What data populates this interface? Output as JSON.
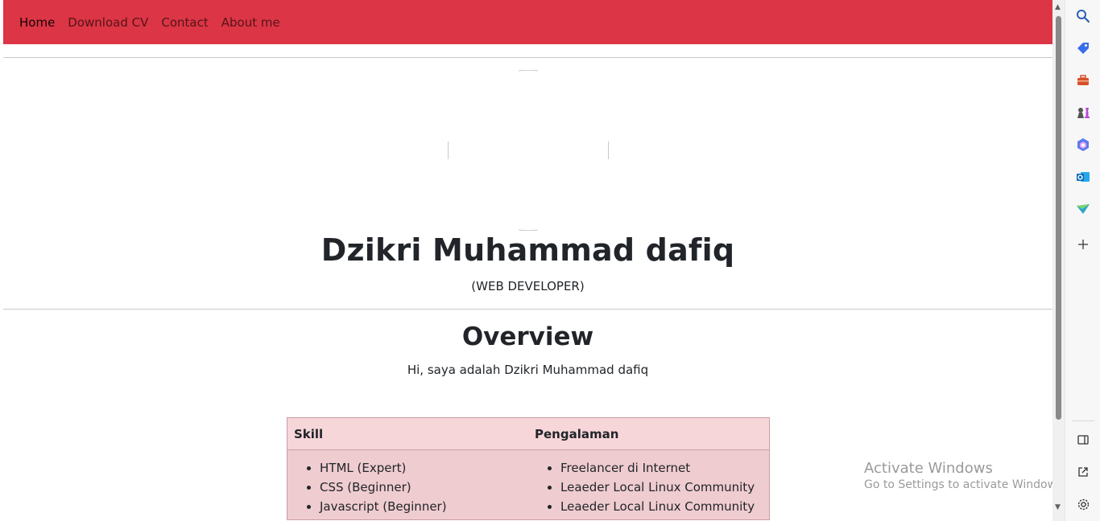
{
  "nav": {
    "items": [
      {
        "label": "Home",
        "active": true
      },
      {
        "label": "Download CV",
        "active": false
      },
      {
        "label": "Contact",
        "active": false
      },
      {
        "label": "About me",
        "active": false
      }
    ]
  },
  "profile": {
    "name": "Dzikri Muhammad dafiq",
    "role": "(WEB DEVELOPER)"
  },
  "overview": {
    "title": "Overview",
    "text": "Hi, saya adalah Dzikri Muhammad dafiq"
  },
  "table": {
    "headers": [
      "Skill",
      "Pengalaman"
    ],
    "skills": [
      "HTML (Expert)",
      "CSS (Beginner)",
      "Javascript (Beginner)"
    ],
    "experience": [
      "Freelancer di Internet",
      "Leaeder Local Linux Community",
      "Leaeder Local Linux Community"
    ]
  },
  "watermark": {
    "line1": "Activate Windows",
    "line2": "Go to Settings to activate Windows."
  },
  "colors": {
    "navbar": "#dc3545",
    "table_header": "#f7d6da",
    "table_body": "#efccd0"
  },
  "sidebar_icons": [
    "search-icon",
    "tag-icon",
    "toolbox-icon",
    "chess-icon",
    "copilot-icon",
    "outlook-icon",
    "send-icon",
    "add-icon",
    "split-screen-icon",
    "external-link-icon",
    "settings-icon"
  ]
}
